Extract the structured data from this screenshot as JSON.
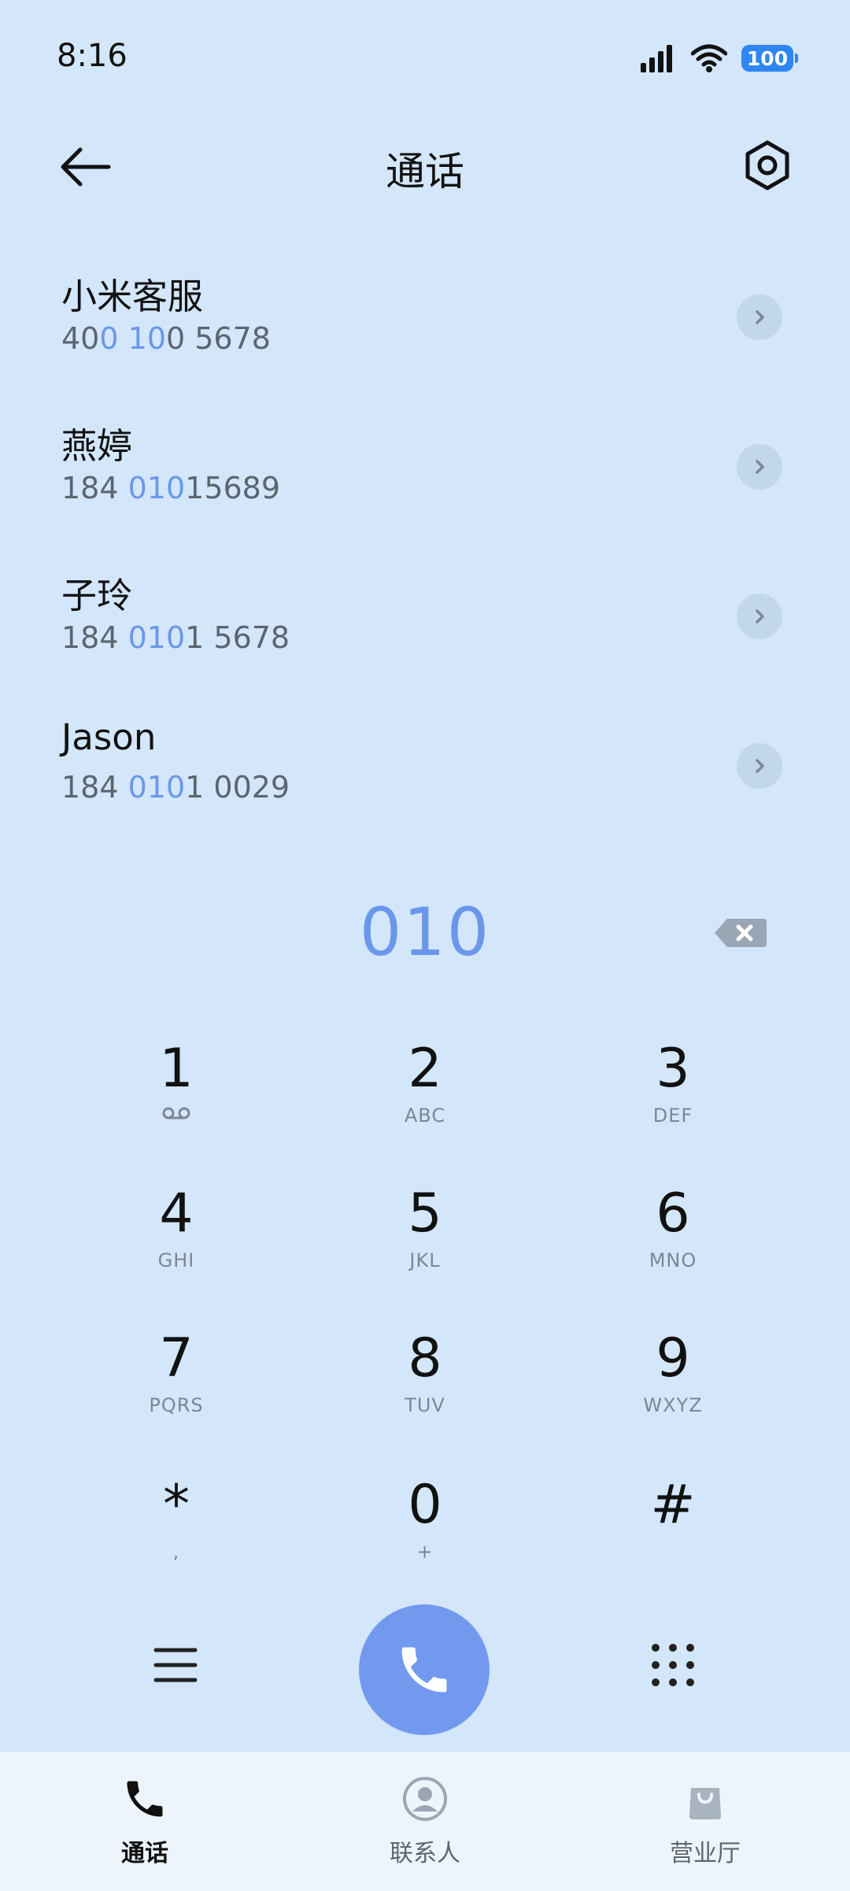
{
  "status_bar": {
    "time": "8:16",
    "battery": "100"
  },
  "header": {
    "title": "通话"
  },
  "contacts": [
    {
      "name": "小米客服",
      "number": [
        {
          "text": "40",
          "hl": false
        },
        {
          "text": "0",
          "hl": true
        },
        {
          "text": " ",
          "hl": false
        },
        {
          "text": "10",
          "hl": true
        },
        {
          "text": "0 5678",
          "hl": false
        }
      ]
    },
    {
      "name": "燕婷",
      "number": [
        {
          "text": "184 ",
          "hl": false
        },
        {
          "text": "010",
          "hl": true
        },
        {
          "text": "15689",
          "hl": false
        }
      ]
    },
    {
      "name": "子玲",
      "number": [
        {
          "text": "184 ",
          "hl": false
        },
        {
          "text": "010",
          "hl": true
        },
        {
          "text": "1 5678",
          "hl": false
        }
      ]
    },
    {
      "name": "Jason",
      "number": [
        {
          "text": "184 ",
          "hl": false
        },
        {
          "text": "010",
          "hl": true
        },
        {
          "text": "1 0029",
          "hl": false
        }
      ]
    }
  ],
  "dial_input": {
    "value": "010"
  },
  "keypad": [
    {
      "digit": "1",
      "letters": "",
      "icon": "voicemail-icon"
    },
    {
      "digit": "2",
      "letters": "ABC"
    },
    {
      "digit": "3",
      "letters": "DEF"
    },
    {
      "digit": "4",
      "letters": "GHI"
    },
    {
      "digit": "5",
      "letters": "JKL"
    },
    {
      "digit": "6",
      "letters": "MNO"
    },
    {
      "digit": "7",
      "letters": "PQRS"
    },
    {
      "digit": "8",
      "letters": "TUV"
    },
    {
      "digit": "9",
      "letters": "WXYZ"
    },
    {
      "digit": "*",
      "letters": ","
    },
    {
      "digit": "0",
      "letters": "+"
    },
    {
      "digit": "#",
      "letters": ""
    }
  ],
  "bottom_nav": [
    {
      "label": "通话",
      "icon": "phone-icon",
      "active": true
    },
    {
      "label": "联系人",
      "icon": "contact-icon",
      "active": false
    },
    {
      "label": "营业厅",
      "icon": "shopping-bag-icon",
      "active": false
    }
  ],
  "colors": {
    "background": "#d3e6fa",
    "accent": "#6b97ea",
    "call_button": "#7299ed",
    "battery": "#2f86f2"
  }
}
